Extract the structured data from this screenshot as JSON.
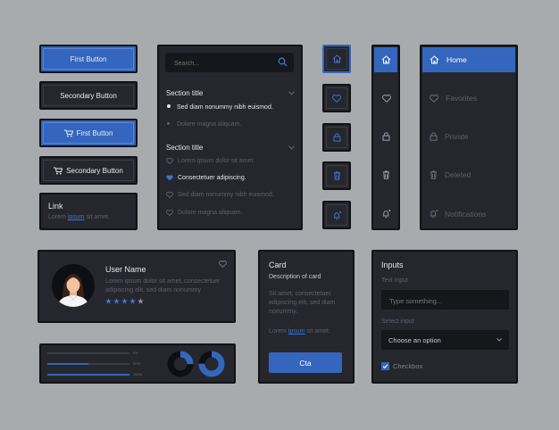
{
  "buttons": {
    "first": "First Button",
    "secondary": "Secondary Button",
    "first_cart": "First Button",
    "secondary_cart": "Secondary Button"
  },
  "link_card": {
    "title": "Link",
    "text_before": "Lorem",
    "link": "ipsum",
    "text_after": "sit amet."
  },
  "search": {
    "placeholder": "Search...",
    "section1": {
      "title": "Section title",
      "items": [
        "Sed diam nonummy nibh euismod.",
        "Dolore magna aliquam."
      ]
    },
    "section2": {
      "title": "Section title",
      "items": [
        "Lorem ipsum dolor sit amet.",
        "Consectetuer adipiscing.",
        "Sed diam nonummy nibh euismod.",
        "Dolore magna aliquam."
      ]
    }
  },
  "nav": {
    "items": [
      "Home",
      "Favorites",
      "Private",
      "Deleted",
      "Notifications"
    ]
  },
  "user": {
    "name": "User Name",
    "bio": "Lorem ipsum dolor sit amet, consectetuer adipiscing elit, sed diam nonummy",
    "rating": 4,
    "rating_max": 5
  },
  "progress": {
    "bars": [
      {
        "label": "0%",
        "value": 0.0
      },
      {
        "label": "50%",
        "value": 0.5
      },
      {
        "label": "100%",
        "value": 1.0
      }
    ],
    "donuts": [
      0.25,
      0.75
    ]
  },
  "card": {
    "title": "Card",
    "subtitle": "Description of card",
    "body": "Sit amet, consectetuer adipiscing elit, sed diam nonummy.",
    "link_before": "Lorem",
    "link": "ipsum",
    "link_after": "sit amet.",
    "cta": "Cta"
  },
  "inputs": {
    "title": "Inputs",
    "text_label": "Text input",
    "text_placeholder": "Type something...",
    "select_label": "Select input",
    "select_value": "Choose an option",
    "checkbox_label": "Checkbox",
    "checkbox_checked": true
  },
  "colors": {
    "background": "#a8abae",
    "panel": "#25272d",
    "accent": "#3566bd"
  }
}
